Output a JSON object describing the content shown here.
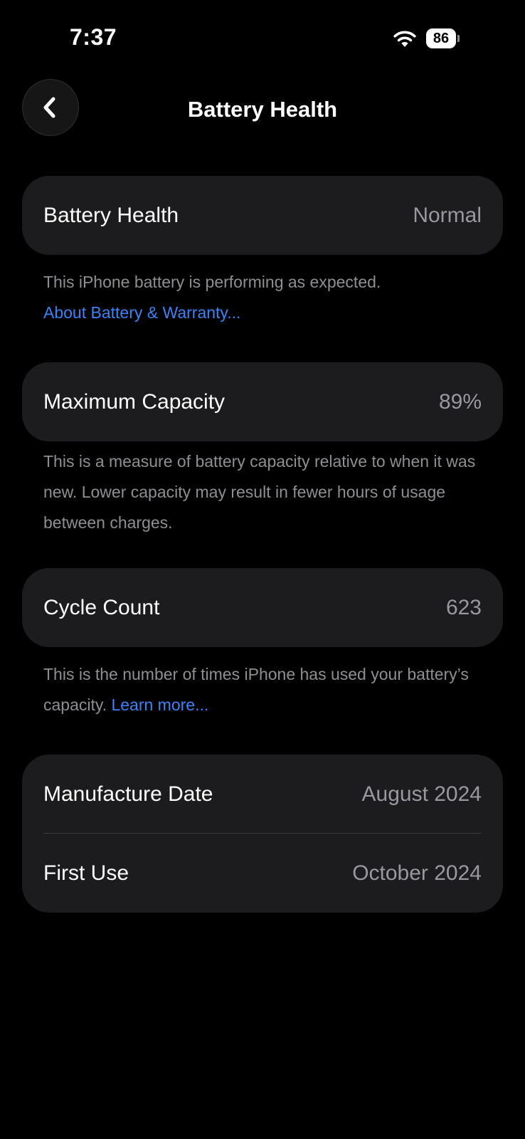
{
  "status_bar": {
    "time": "7:37",
    "battery_level": "86"
  },
  "nav": {
    "title": "Battery Health"
  },
  "battery_health": {
    "label": "Battery Health",
    "value": "Normal",
    "note": "This iPhone battery is performing as expected.",
    "link": "About Battery & Warranty..."
  },
  "max_capacity": {
    "label": "Maximum Capacity",
    "value": "89%",
    "note": "This is a measure of battery capacity relative to when it was new. Lower capacity may result in fewer hours of usage between charges."
  },
  "cycle_count": {
    "label": "Cycle Count",
    "value": "623",
    "note": "This is the number of times iPhone has used your battery’s capacity.",
    "link": "Learn more..."
  },
  "dates": {
    "manufacture_label": "Manufacture Date",
    "manufacture_value": "August 2024",
    "first_use_label": "First Use",
    "first_use_value": "October 2024"
  },
  "colors": {
    "background": "#000000",
    "card": "#1c1c1e",
    "secondary_text": "#8e8e93",
    "link": "#3b82f6"
  },
  "icons": {
    "back": "chevron-left-icon",
    "wifi": "wifi-icon",
    "battery": "battery-icon"
  }
}
